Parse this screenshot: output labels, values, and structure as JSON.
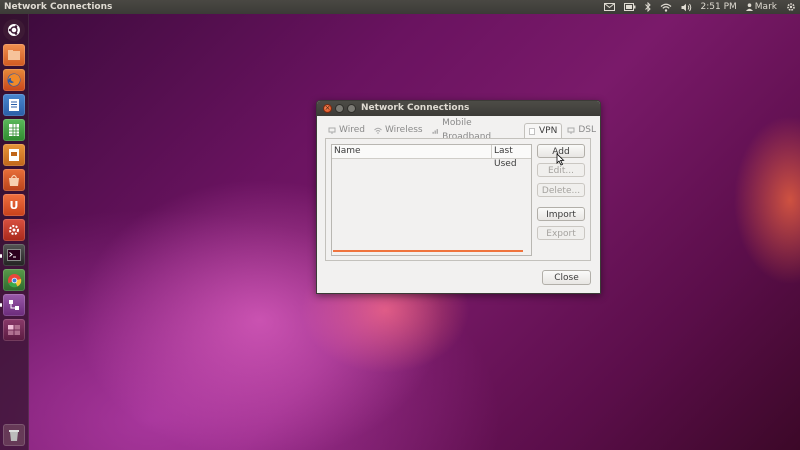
{
  "top_panel": {
    "app_title": "Network Connections",
    "time": "2:51 PM",
    "user": "Mark"
  },
  "launcher": {
    "items": [
      {
        "name": "dash-home",
        "label": "",
        "color": "#e05a30",
        "glyph": "◎"
      },
      {
        "name": "files",
        "label": "",
        "color": "#e07030",
        "glyph": ""
      },
      {
        "name": "firefox",
        "label": "",
        "color": "#e8702a",
        "glyph": ""
      },
      {
        "name": "libreoffice-writer",
        "label": "",
        "color": "#2f6fb7",
        "glyph": ""
      },
      {
        "name": "libreoffice-calc",
        "label": "",
        "color": "#3c9a3c",
        "glyph": ""
      },
      {
        "name": "libreoffice-impress",
        "label": "",
        "color": "#d27a2a",
        "glyph": ""
      },
      {
        "name": "software-center",
        "label": "",
        "color": "#d9531e",
        "glyph": ""
      },
      {
        "name": "ubuntu-one",
        "label": "U",
        "color": "#e0502a",
        "glyph": "U"
      },
      {
        "name": "system-settings",
        "label": "",
        "color": "#c0392b",
        "glyph": ""
      },
      {
        "name": "terminal",
        "label": "",
        "color": "#2c2c2c",
        "glyph": ""
      },
      {
        "name": "chrome",
        "label": "",
        "color": "#4a8a3a",
        "glyph": ""
      },
      {
        "name": "network-tool",
        "label": "",
        "color": "#8a4a9a",
        "glyph": ""
      },
      {
        "name": "workspace-switcher",
        "label": "",
        "color": "#7a2a5a",
        "glyph": ""
      },
      {
        "name": "trash",
        "label": "",
        "color": "#7a5a6a",
        "glyph": ""
      }
    ]
  },
  "window": {
    "title": "Network Connections",
    "tabs": [
      {
        "label": "Wired",
        "active": false
      },
      {
        "label": "Wireless",
        "active": false
      },
      {
        "label": "Mobile Broadband",
        "active": false
      },
      {
        "label": "VPN",
        "active": true
      },
      {
        "label": "DSL",
        "active": false
      }
    ],
    "list": {
      "columns": [
        "Name",
        "Last Used"
      ],
      "rows": []
    },
    "buttons": {
      "add": "Add",
      "edit": "Edit...",
      "delete": "Delete...",
      "import": "Import",
      "export": "Export",
      "close": "Close"
    }
  },
  "colors": {
    "accent": "#f0743e",
    "panel": "#3c3b37"
  }
}
